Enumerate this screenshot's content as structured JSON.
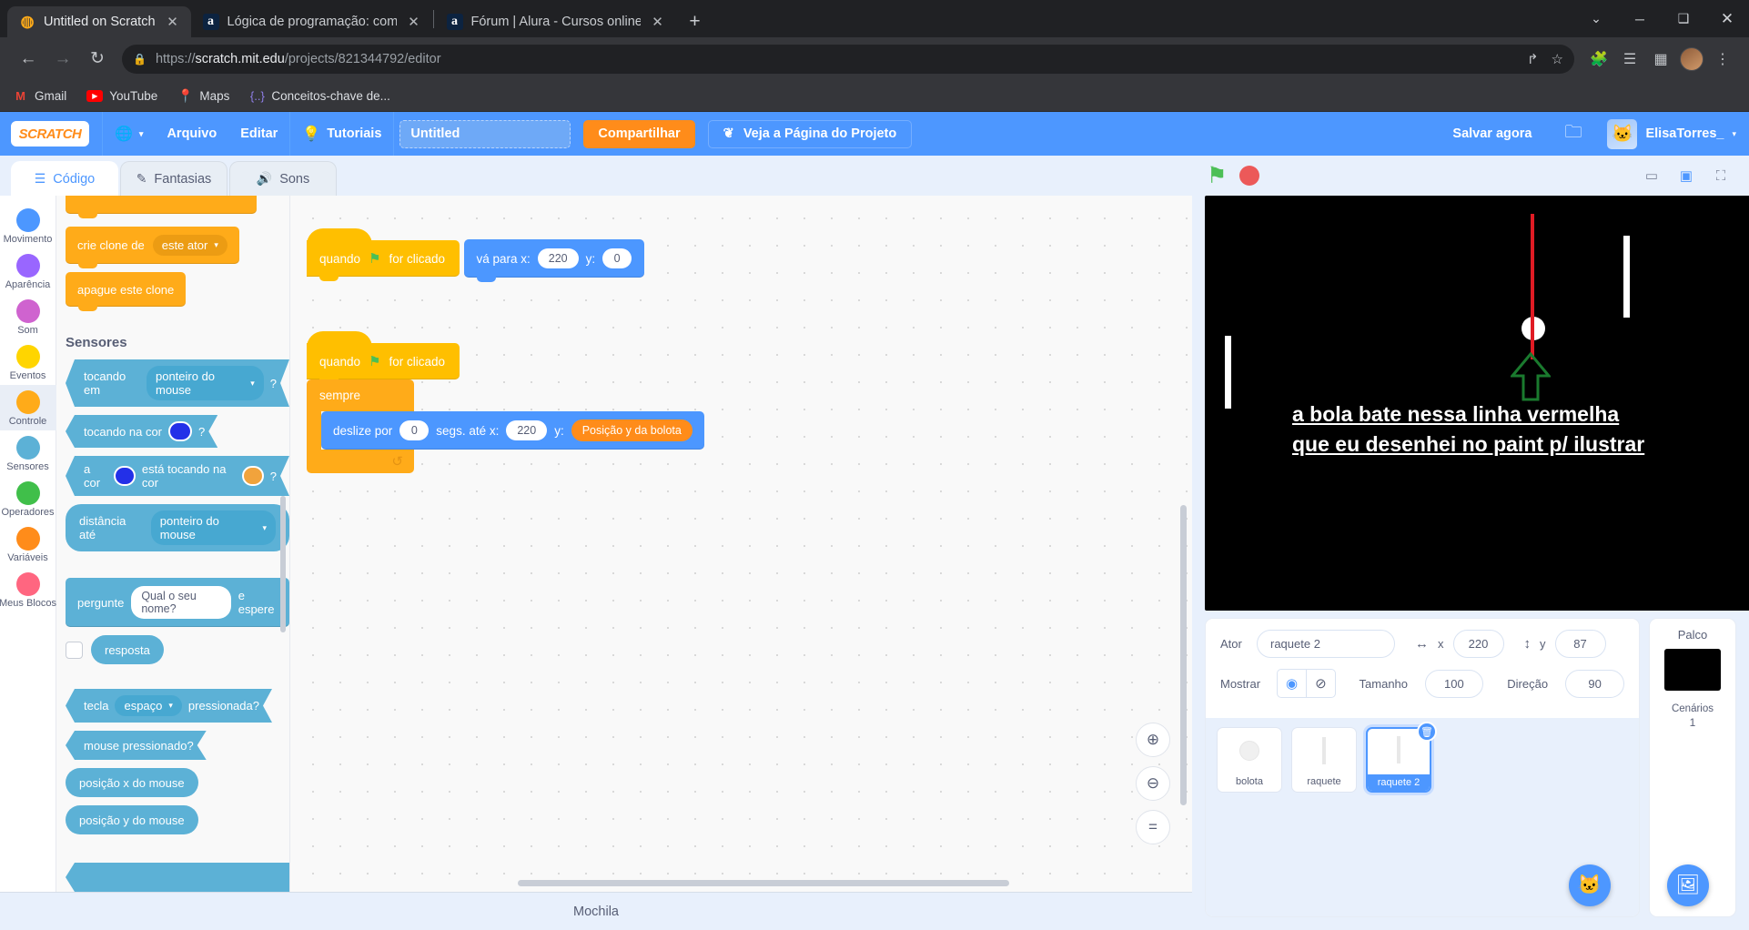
{
  "browser": {
    "tabs": [
      {
        "title": "Untitled on Scratch",
        "favicon": "scratch-icon",
        "active": true,
        "close": "✕"
      },
      {
        "title": "Lógica de programação: comece",
        "favicon": "alura-icon",
        "active": false,
        "close": "✕"
      },
      {
        "title": "Fórum | Alura - Cursos online de",
        "favicon": "alura-icon",
        "active": false,
        "close": "✕"
      }
    ],
    "new_tab_label": "+",
    "window_controls": {
      "minimize_chrome": "⌄",
      "minimize": "─",
      "maximize": "❑",
      "close": "✕"
    },
    "nav": {
      "back": "←",
      "forward": "→",
      "reload": "↻"
    },
    "url": {
      "lock": "🔒",
      "scheme": "https://",
      "domain": "scratch.mit.edu",
      "path": "/projects/821344792/editor"
    },
    "omnibox_icons": {
      "share": "↱",
      "bookmark": "☆"
    },
    "toolbar_icons": {
      "extensions": "🧩",
      "reading_list": "☰",
      "sidepanel": "▧",
      "menu": "⋮"
    },
    "bookmarks": [
      {
        "label": "Gmail",
        "icon": "gmail-icon"
      },
      {
        "label": "YouTube",
        "icon": "youtube-icon"
      },
      {
        "label": "Maps",
        "icon": "maps-icon"
      },
      {
        "label": "Conceitos-chave de...",
        "icon": "braces-icon"
      }
    ]
  },
  "menubar": {
    "logo": "SCRATCH",
    "globe_icon": "🌐",
    "caret": "▾",
    "file": "Arquivo",
    "edit": "Editar",
    "tutorials": "Tutoriais",
    "tutorials_icon": "💡",
    "project_name": "Untitled",
    "share": "Compartilhar",
    "project_page": "Veja a Página do Projeto",
    "project_page_icon": "❦",
    "save_now": "Salvar agora",
    "folder_icon": "🗀",
    "username": "ElisaTorres_",
    "user_caret": "▾"
  },
  "tabs": [
    {
      "label": "Código",
      "icon": "code-icon",
      "glyph": "☰",
      "active": true
    },
    {
      "label": "Fantasias",
      "icon": "paintbrush-icon",
      "glyph": "✎",
      "active": false
    },
    {
      "label": "Sons",
      "icon": "speaker-icon",
      "glyph": "🔊",
      "active": false
    }
  ],
  "categories": [
    {
      "label": "Movimento",
      "color": "#4c97ff",
      "selected": false
    },
    {
      "label": "Aparência",
      "color": "#9966ff",
      "selected": false
    },
    {
      "label": "Som",
      "color": "#cf63cf",
      "selected": false
    },
    {
      "label": "Eventos",
      "color": "#ffd500",
      "selected": false
    },
    {
      "label": "Controle",
      "color": "#ffab19",
      "selected": true
    },
    {
      "label": "Sensores",
      "color": "#5cb1d6",
      "selected": false
    },
    {
      "label": "Operadores",
      "color": "#40bf4a",
      "selected": false
    },
    {
      "label": "Variáveis",
      "color": "#ff8c1a",
      "selected": false
    },
    {
      "label": "Meus Blocos",
      "color": "#ff6680",
      "selected": false
    }
  ],
  "palette": {
    "clone_create": {
      "text": "crie clone de",
      "dropdown": "este ator",
      "caret": "▾"
    },
    "clone_delete": {
      "text": "apague este clone"
    },
    "section_header": "Sensores",
    "touching": {
      "text": "tocando em",
      "dropdown": "ponteiro do mouse",
      "caret": "▾",
      "q": "?"
    },
    "touching_color": {
      "text": "tocando na cor",
      "color": "#2330e8",
      "q": "?"
    },
    "color_touching": {
      "text_a": "a cor",
      "color_a": "#2330e8",
      "text_b": "está tocando na cor",
      "color_b": "#f1a33c",
      "q": "?"
    },
    "distance": {
      "text": "distância até",
      "dropdown": "ponteiro do mouse",
      "caret": "▾"
    },
    "ask": {
      "text_a": "pergunte",
      "value": "Qual o seu nome?",
      "text_b": "e espere"
    },
    "answer": {
      "label": "resposta",
      "checked": false
    },
    "key_pressed": {
      "text_a": "tecla",
      "dropdown": "espaço",
      "caret": "▾",
      "text_b": "pressionada?"
    },
    "mouse_down": {
      "text": "mouse pressionado?"
    },
    "mouse_x": {
      "text": "posição x do mouse"
    },
    "mouse_y": {
      "text": "posição y do mouse"
    }
  },
  "scripts": [
    {
      "hat": {
        "text_a": "quando",
        "flag": "⚑",
        "text_b": "for clicado"
      },
      "blocks": [
        {
          "type": "goto",
          "text_a": "vá para x:",
          "x": "220",
          "text_b": "y:",
          "y": "0"
        }
      ]
    },
    {
      "hat": {
        "text_a": "quando",
        "flag": "⚑",
        "text_b": "for clicado"
      },
      "loop": {
        "label": "sempre",
        "arrow": "↺",
        "inner": {
          "text_a": "deslize por",
          "secs": "0",
          "text_b": "segs. até x:",
          "x": "220",
          "text_c": "y:",
          "variable": "Posição y da bolota"
        }
      }
    }
  ],
  "canvas_controls": {
    "zoom_in": "⊕",
    "zoom_out": "⊖",
    "zoom_reset": "〓"
  },
  "backpack": {
    "label": "Mochila"
  },
  "stage_controls": {
    "green_flag": "⚑",
    "stop": "stop-icon",
    "small": "▭",
    "large": "▣",
    "fullscreen": "⛶"
  },
  "stage": {
    "annotation_line1": "a bola bate nessa linha vermelha",
    "annotation_line2": "que eu desenhei no paint p/ ilustrar",
    "ball_color": "#ffffff",
    "redline_color": "#e01b24",
    "paddle_color": "#ffffff",
    "arrow_color": "#1a7a2e"
  },
  "sprite_info": {
    "actor_label": "Ator",
    "actor_name": "raquete 2",
    "x_label": "x",
    "x_value": "220",
    "y_label": "y",
    "y_value": "87",
    "x_icon": "↔",
    "y_icon": "↕",
    "show_label": "Mostrar",
    "show_on_icon": "◉",
    "show_off_icon": "⊘",
    "size_label": "Tamanho",
    "size_value": "100",
    "direction_label": "Direção",
    "direction_value": "90"
  },
  "sprites": [
    {
      "name": "bolota",
      "thumb": "ball-thumb",
      "selected": false
    },
    {
      "name": "raquete",
      "thumb": "paddle-thumb",
      "selected": false
    },
    {
      "name": "raquete 2",
      "thumb": "paddle-thumb",
      "selected": true,
      "delete_icon": "🗑"
    }
  ],
  "stage_pane": {
    "title": "Palco",
    "backdrops_label": "Cenários",
    "backdrops_count": "1"
  },
  "fabs": {
    "add_sprite": "🐱",
    "add_backdrop": "🖼"
  }
}
